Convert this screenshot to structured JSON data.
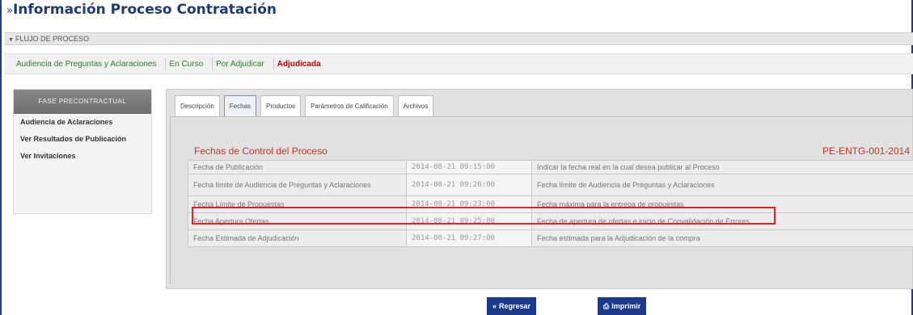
{
  "header": {
    "title_prefix": "»",
    "title": "Información Proceso Contratación",
    "flujo_label": "FLUJO DE PROCESO"
  },
  "steps": [
    {
      "label": "Audiencia de Preguntas y Aclaraciones"
    },
    {
      "label": "En Curso"
    },
    {
      "label": "Por Adjudicar"
    },
    {
      "label": "Adjudicada"
    }
  ],
  "sidebar": {
    "header": "FASE PRECONTRACTUAL",
    "items": [
      {
        "label": "Audiencia de Aclaraciones"
      },
      {
        "label": "Ver Resultados de Publicación"
      },
      {
        "label": "Ver Invitaciones"
      }
    ]
  },
  "tabs": [
    {
      "label": "Descripción"
    },
    {
      "label": "Fechas"
    },
    {
      "label": "Productos"
    },
    {
      "label": "Parámetros de Calificación"
    },
    {
      "label": "Archivos"
    }
  ],
  "section": {
    "title": "Fechas de Control del Proceso",
    "code": "PE-ENTG-001-2014"
  },
  "dates": [
    {
      "name": "Fecha de Publicación",
      "value": "2014-08-21 09:15:00",
      "desc": "Indicar la fecha real en la cual desea publicar al Proceso"
    },
    {
      "name": "Fecha límite de Audiencia de Preguntas y Aclaraciones",
      "value": "2014-08-21 09:20:00",
      "desc": "Fecha límite de Audiencia de Preguntas y Aclaraciones"
    },
    {
      "name": "Fecha Límite de Propuestas",
      "value": "2014-08-21 09:23:00",
      "desc": "Fecha máxima para la entrega de propuestas"
    },
    {
      "name": "Fecha Apertura Ofertas",
      "value": "2014-08-21 09:25:00",
      "desc": "Fecha de apertura de ofertas e inicio de Convalidación de Errores"
    },
    {
      "name": "Fecha Estimada de Adjudicación",
      "value": "2014-08-21 09:27:00",
      "desc": "Fecha estimada para la Adjudicación de la compra"
    }
  ],
  "buttons": {
    "back": "Regresar",
    "print": "Imprimir"
  },
  "colors": {
    "accent": "#1b3a8c",
    "active_step": "#c00000",
    "highlight": "#e02424"
  }
}
